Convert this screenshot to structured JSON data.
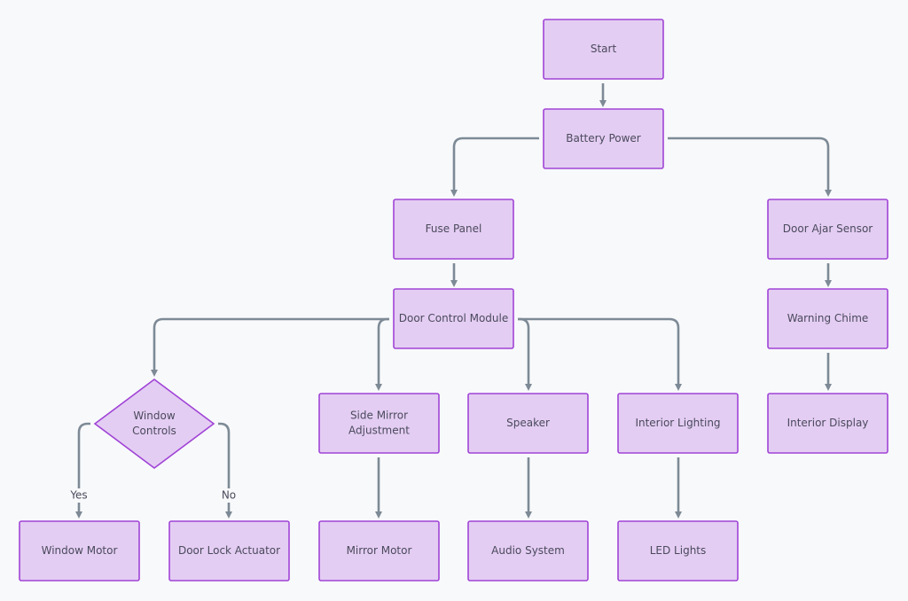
{
  "diagram": {
    "colors": {
      "node_fill": "#e4cdf3",
      "node_stroke": "#a044d6",
      "edge": "#7d8a96",
      "background": "#f8f9fb",
      "text": "#4a4a5c"
    },
    "nodes": [
      {
        "id": "start",
        "label": [
          "Start"
        ],
        "shape": "rect"
      },
      {
        "id": "battery",
        "label": [
          "Battery Power"
        ],
        "shape": "rect"
      },
      {
        "id": "fuse",
        "label": [
          "Fuse Panel"
        ],
        "shape": "rect"
      },
      {
        "id": "ajar",
        "label": [
          "Door Ajar Sensor"
        ],
        "shape": "rect"
      },
      {
        "id": "dcm",
        "label": [
          "Door Control Module"
        ],
        "shape": "rect"
      },
      {
        "id": "chime",
        "label": [
          "Warning Chime"
        ],
        "shape": "rect"
      },
      {
        "id": "window",
        "label": [
          "Window",
          "Controls"
        ],
        "shape": "diamond"
      },
      {
        "id": "mirror",
        "label": [
          "Side Mirror",
          "Adjustment"
        ],
        "shape": "rect"
      },
      {
        "id": "speaker",
        "label": [
          "Speaker"
        ],
        "shape": "rect"
      },
      {
        "id": "lighting",
        "label": [
          "Interior Lighting"
        ],
        "shape": "rect"
      },
      {
        "id": "display",
        "label": [
          "Interior Display"
        ],
        "shape": "rect"
      },
      {
        "id": "wmotor",
        "label": [
          "Window Motor"
        ],
        "shape": "rect"
      },
      {
        "id": "lock",
        "label": [
          "Door Lock Actuator"
        ],
        "shape": "rect"
      },
      {
        "id": "mmotor",
        "label": [
          "Mirror Motor"
        ],
        "shape": "rect"
      },
      {
        "id": "audio",
        "label": [
          "Audio System"
        ],
        "shape": "rect"
      },
      {
        "id": "led",
        "label": [
          "LED Lights"
        ],
        "shape": "rect"
      }
    ],
    "edges": [
      {
        "from": "start",
        "to": "battery"
      },
      {
        "from": "battery",
        "to": "fuse"
      },
      {
        "from": "battery",
        "to": "ajar"
      },
      {
        "from": "fuse",
        "to": "dcm"
      },
      {
        "from": "ajar",
        "to": "chime"
      },
      {
        "from": "dcm",
        "to": "window"
      },
      {
        "from": "dcm",
        "to": "mirror"
      },
      {
        "from": "dcm",
        "to": "speaker"
      },
      {
        "from": "dcm",
        "to": "lighting"
      },
      {
        "from": "chime",
        "to": "display"
      },
      {
        "from": "window",
        "to": "wmotor",
        "label": "Yes"
      },
      {
        "from": "window",
        "to": "lock",
        "label": "No"
      },
      {
        "from": "mirror",
        "to": "mmotor"
      },
      {
        "from": "speaker",
        "to": "audio"
      },
      {
        "from": "lighting",
        "to": "led"
      }
    ]
  }
}
